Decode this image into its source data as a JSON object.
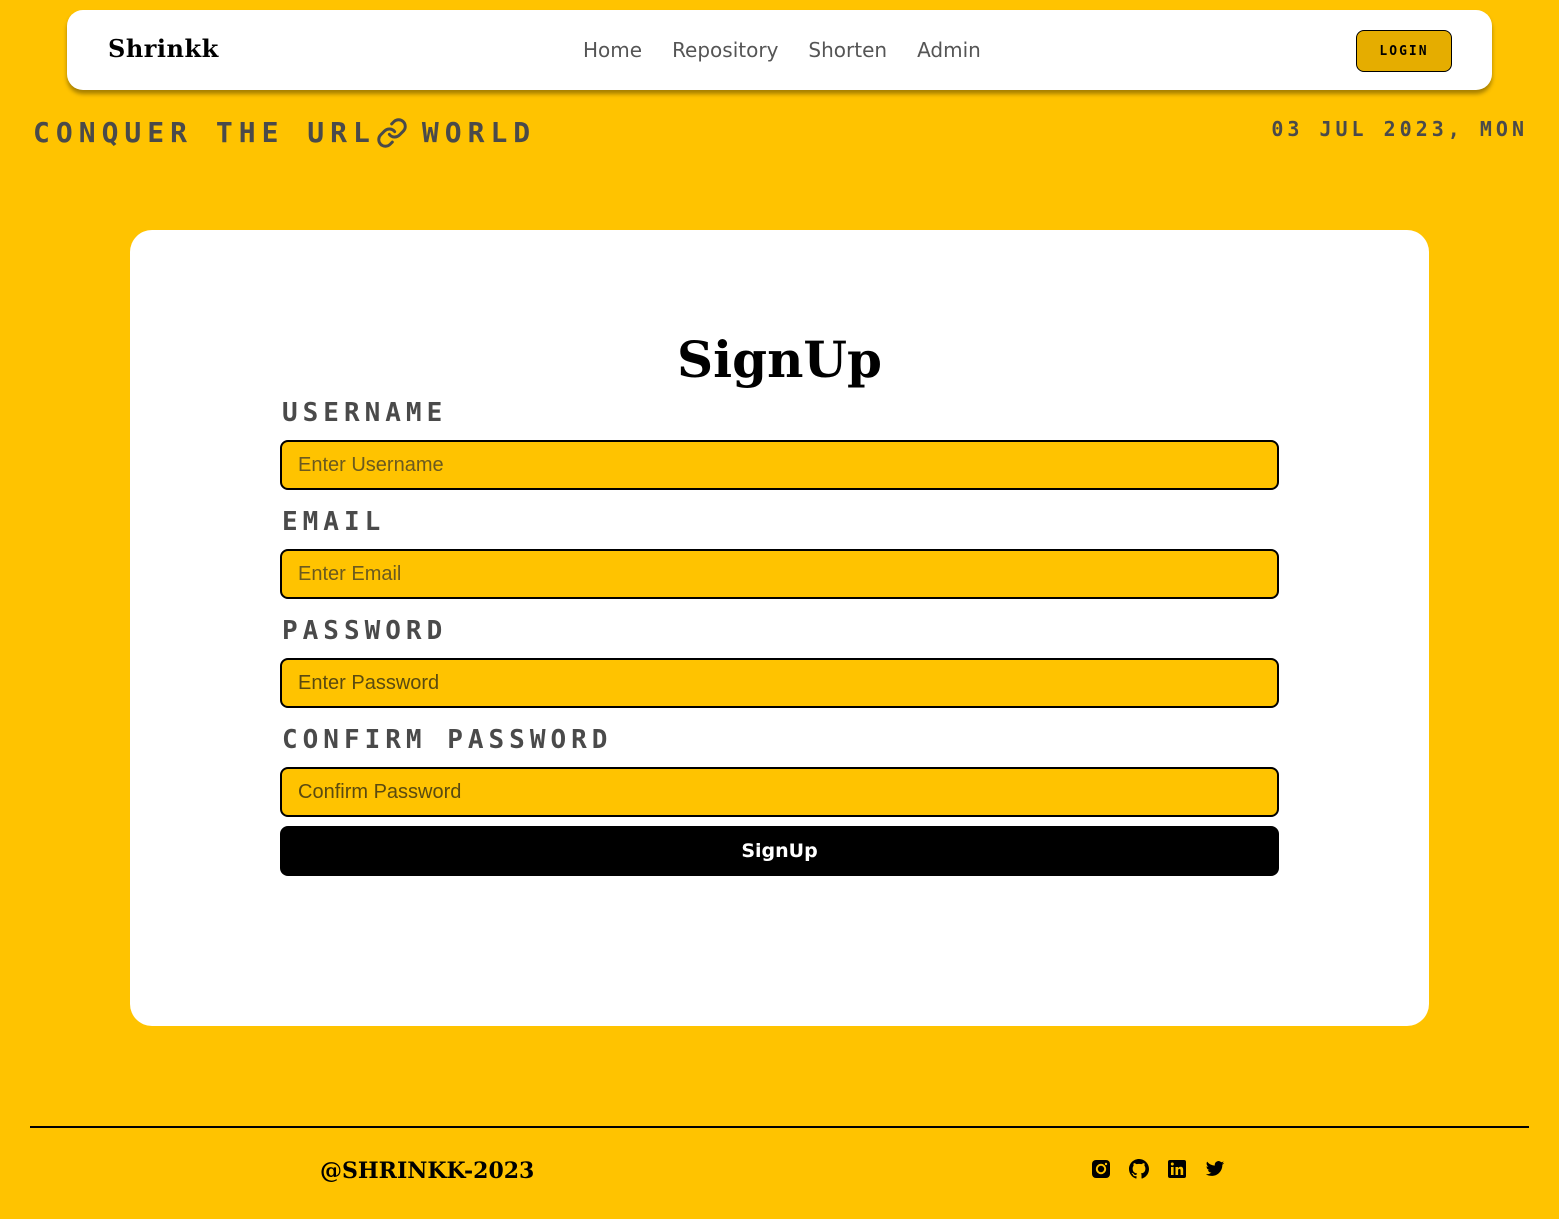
{
  "navbar": {
    "brand": "Shrinkk",
    "links": [
      "Home",
      "Repository",
      "Shorten",
      "Admin"
    ],
    "login_label": "LOGIN"
  },
  "header": {
    "tagline_left": "CONQUER THE URL",
    "tagline_icon": "link-icon",
    "tagline_right": "WORLD",
    "date": "03 JUL 2023, MON"
  },
  "form": {
    "title": "SignUp",
    "username": {
      "label": "USERNAME",
      "placeholder": "Enter Username"
    },
    "email": {
      "label": "EMAIL",
      "placeholder": "Enter Email"
    },
    "password": {
      "label": "PASSWORD",
      "placeholder": "Enter Password"
    },
    "confirm": {
      "label": "CONFIRM PASSWORD",
      "placeholder": "Confirm Password"
    },
    "submit_label": "SignUp"
  },
  "footer": {
    "copyright": "@SHRINKK-2023",
    "socials": [
      "instagram-icon",
      "github-icon",
      "linkedin-icon",
      "twitter-icon"
    ]
  },
  "colors": {
    "background": "#ffc300",
    "card": "#ffffff",
    "login_button": "#e5ad00",
    "submit_button": "#000000"
  }
}
